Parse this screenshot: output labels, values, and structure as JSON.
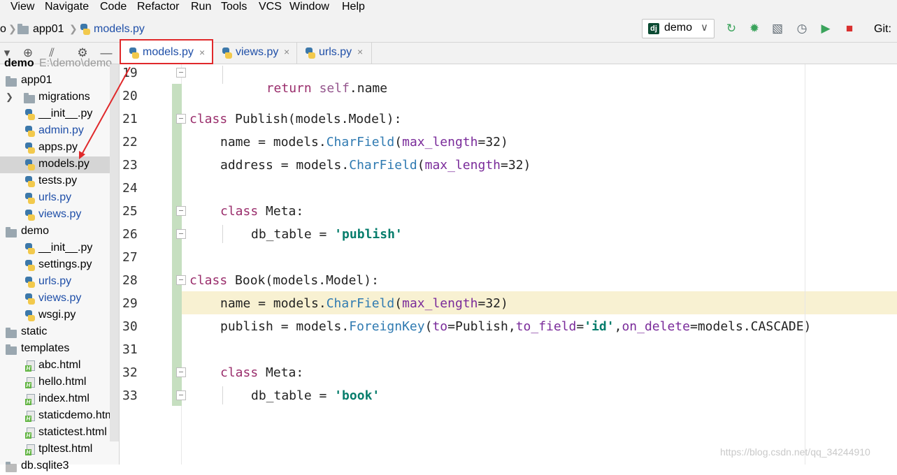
{
  "menu": [
    "View",
    "Navigate",
    "Code",
    "Refactor",
    "Run",
    "Tools",
    "VCS",
    "Window",
    "Help"
  ],
  "breadcrumb": {
    "project": "o",
    "folder": "app01",
    "file": "models.py"
  },
  "run_config": {
    "name": "demo"
  },
  "git_label": "Git:",
  "tabs": [
    {
      "label": "models.py",
      "close": "×"
    },
    {
      "label": "views.py",
      "close": "×"
    },
    {
      "label": "urls.py",
      "close": "×"
    }
  ],
  "tree": {
    "root_label": "demo",
    "root_path": "E:\\demo\\demo",
    "items": [
      {
        "label": "app01",
        "kind": "folder",
        "level": 0
      },
      {
        "label": "migrations",
        "kind": "folder",
        "level": 1
      },
      {
        "label": "__init__.py",
        "kind": "py",
        "level": 1
      },
      {
        "label": "admin.py",
        "kind": "py",
        "level": 1
      },
      {
        "label": "apps.py",
        "kind": "py",
        "level": 1
      },
      {
        "label": "models.py",
        "kind": "py",
        "level": 1
      },
      {
        "label": "tests.py",
        "kind": "py",
        "level": 1
      },
      {
        "label": "urls.py",
        "kind": "py",
        "level": 1
      },
      {
        "label": "views.py",
        "kind": "py",
        "level": 1
      },
      {
        "label": "demo",
        "kind": "folder",
        "level": 0
      },
      {
        "label": "__init__.py",
        "kind": "py",
        "level": 1
      },
      {
        "label": "settings.py",
        "kind": "py",
        "level": 1
      },
      {
        "label": "urls.py",
        "kind": "py",
        "level": 1
      },
      {
        "label": "views.py",
        "kind": "py",
        "level": 1
      },
      {
        "label": "wsgi.py",
        "kind": "py",
        "level": 1
      },
      {
        "label": "static",
        "kind": "folder",
        "level": 0
      },
      {
        "label": "templates",
        "kind": "folder",
        "level": 0
      },
      {
        "label": "abc.html",
        "kind": "html",
        "level": 1
      },
      {
        "label": "hello.html",
        "kind": "html",
        "level": 1
      },
      {
        "label": "index.html",
        "kind": "html",
        "level": 1
      },
      {
        "label": "staticdemo.htm",
        "kind": "html",
        "level": 1
      },
      {
        "label": "statictest.html",
        "kind": "html",
        "level": 1
      },
      {
        "label": "tpltest.html",
        "kind": "html",
        "level": 1
      },
      {
        "label": "db.sqlite3",
        "kind": "file",
        "level": 0
      }
    ]
  },
  "editor": {
    "line_numbers": [
      "19",
      "20",
      "21",
      "22",
      "23",
      "24",
      "25",
      "26",
      "27",
      "28",
      "29",
      "30",
      "31",
      "32",
      "33"
    ],
    "current_line": "29",
    "lines": {
      "l19": "return self.name",
      "l21a": "class",
      "l21b": " Publish(models.Model):",
      "l22a": "name = models.",
      "l22b": "CharField",
      "l22c": "(",
      "l22d": "max_length",
      "l22e": "=32)",
      "l23a": "address = models.",
      "l23b": "CharField",
      "l23c": "(",
      "l23d": "max_length",
      "l23e": "=32)",
      "l25a": "class",
      "l25b": " Meta:",
      "l26a": "db_table = ",
      "l26b": "'publish'",
      "l28a": "class",
      "l28b": " Book(models.Model):",
      "l29a": "name = models.",
      "l29b": "CharField",
      "l29c": "(",
      "l29d": "max_length",
      "l29e": "=32)",
      "l30a": "publish = models.",
      "l30b": "ForeignKey",
      "l30c": "(",
      "l30d": "to",
      "l30e": "=Publish,",
      "l30f": "to_field",
      "l30g": "=",
      "l30h": "'id'",
      "l30i": ",",
      "l30j": "on_delete",
      "l30k": "=models.CASCADE)",
      "l32a": "class",
      "l32b": " Meta:",
      "l33a": "db_table = ",
      "l33b": "'book'"
    }
  },
  "watermark": "https://blog.csdn.net/qq_34244910",
  "colors": {
    "highlight_box": "#e0292b",
    "caret_line": "#f8f1d2",
    "change_bar": "#c6dfc0",
    "keyword": "#9a2e6c"
  }
}
